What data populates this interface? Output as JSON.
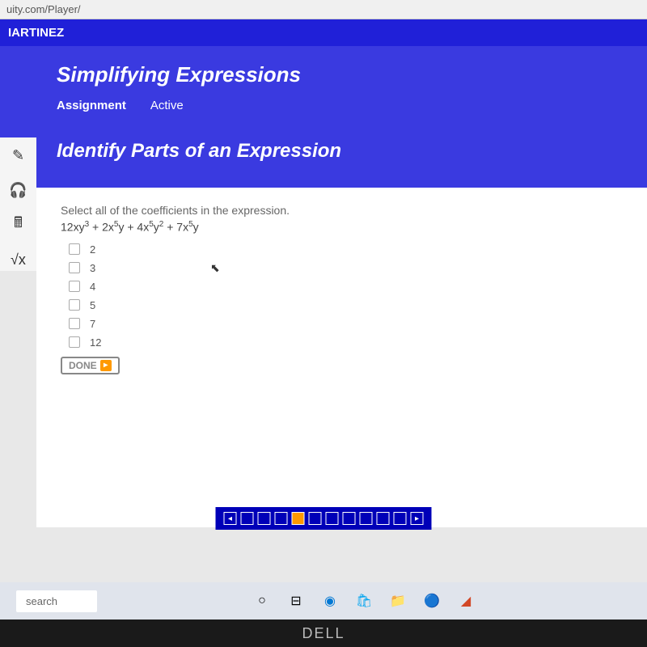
{
  "address_bar": "uity.com/Player/",
  "user_name": "IARTINEZ",
  "page_title": "Simplifying Expressions",
  "tabs": {
    "assignment": "Assignment",
    "active": "Active"
  },
  "section_title": "Identify Parts of an Expression",
  "prompt": "Select all of the coefficients in the expression.",
  "expression": "12xy³ + 2x⁵y + 4x⁵y² + 7x⁵y",
  "options": [
    "2",
    "3",
    "4",
    "5",
    "7",
    "12"
  ],
  "done_label": "DONE",
  "pager_total": 10,
  "pager_active": 4,
  "taskbar": {
    "search": "search"
  },
  "brand": "DELL"
}
